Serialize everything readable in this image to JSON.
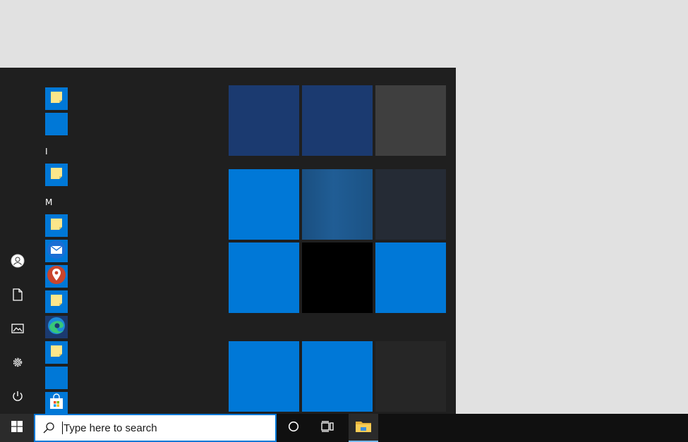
{
  "start_menu": {
    "rail": {
      "items": [
        {
          "name": "account",
          "icon": "user-icon"
        },
        {
          "name": "documents",
          "icon": "document-icon"
        },
        {
          "name": "pictures",
          "icon": "pictures-icon"
        },
        {
          "name": "settings",
          "icon": "gear-icon"
        },
        {
          "name": "power",
          "icon": "power-icon"
        }
      ]
    },
    "app_list": {
      "letters": [
        "I",
        "M"
      ],
      "apps": [
        {
          "icon": "sticky-note-icon"
        },
        {
          "icon": "blank-app-icon"
        },
        {
          "icon": "sticky-note-icon"
        },
        {
          "icon": "sticky-note-icon"
        },
        {
          "icon": "mail-icon"
        },
        {
          "icon": "maps-icon"
        },
        {
          "icon": "sticky-note-icon"
        },
        {
          "icon": "edge-icon"
        },
        {
          "icon": "sticky-note-icon"
        },
        {
          "icon": "blank-app-icon"
        },
        {
          "icon": "store-icon"
        }
      ]
    },
    "tiles": {
      "colors": {
        "navy": "#1b3a70",
        "gray": "#3f3f3f",
        "blue": "#0078d7",
        "teal_gradient": "#1e5687",
        "slate": "#252b35",
        "black": "#000000",
        "dark": "#262626"
      }
    }
  },
  "taskbar": {
    "start_icon": "windows-logo-icon",
    "search": {
      "placeholder": "Type here to search"
    },
    "buttons": [
      {
        "name": "cortana",
        "icon": "circle-icon"
      },
      {
        "name": "task-view",
        "icon": "task-view-icon"
      },
      {
        "name": "file-explorer",
        "icon": "folder-icon"
      }
    ]
  }
}
